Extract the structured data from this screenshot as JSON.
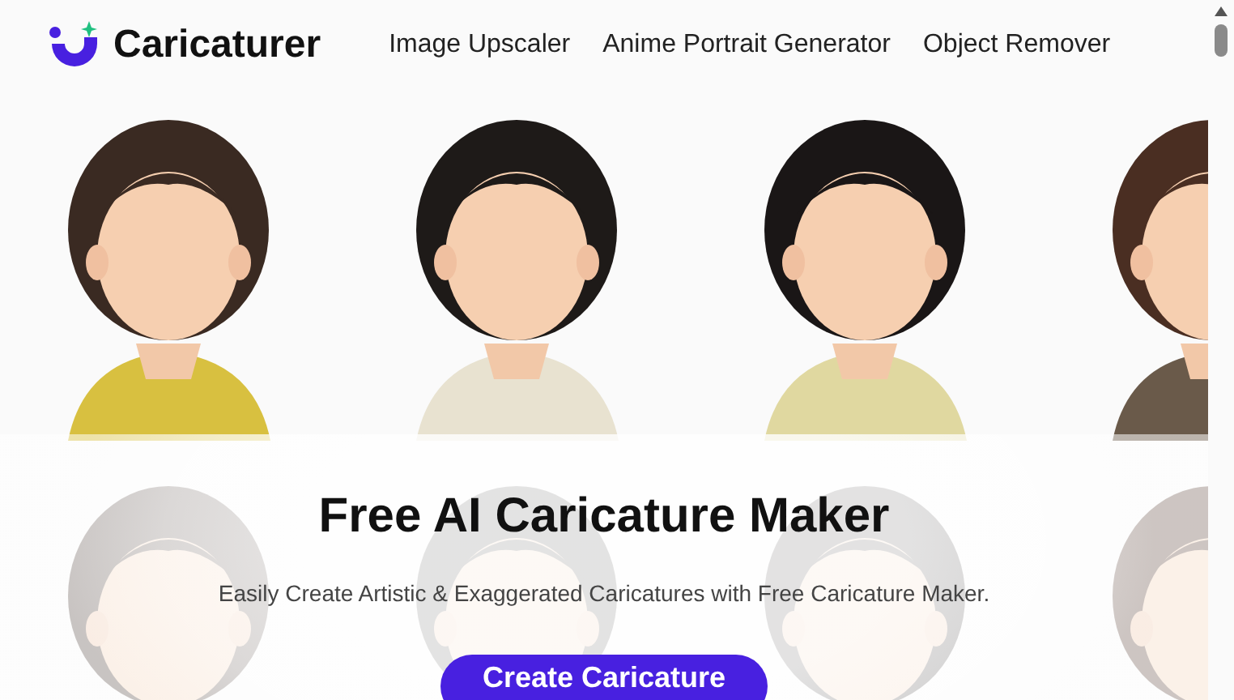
{
  "header": {
    "logo": "Caricaturer",
    "nav": [
      {
        "label": "Image Upscaler"
      },
      {
        "label": "Anime Portrait Generator"
      },
      {
        "label": "Object Remover"
      }
    ]
  },
  "hero": {
    "title": "Free AI Caricature Maker",
    "subtitle": "Easily Create Artistic & Exaggerated Caricatures with Free Caricature Maker.",
    "button": "Create Caricature"
  }
}
